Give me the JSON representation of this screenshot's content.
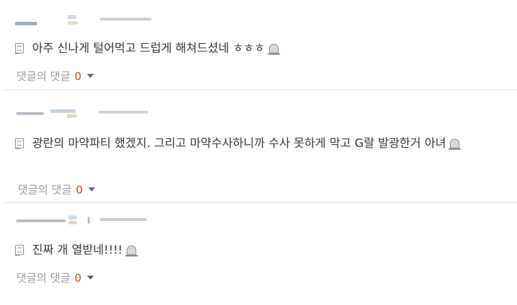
{
  "comments": [
    {
      "text": "아주 신나게 털어먹고 드럽게 해쳐드셨네 ㅎㅎㅎ",
      "reply_label": "댓글의 댓글",
      "reply_count": "0",
      "icons": [
        "memo-icon",
        "grave-icon",
        "caret-down-icon"
      ]
    },
    {
      "text": "광란의 마약파티 했겠지. 그리고 마약수사하니까 수사 못하게 막고 G랄 발광한거 아녀",
      "reply_label": "댓글의 댓글",
      "reply_count": "0",
      "icons": [
        "memo-icon",
        "grave-icon",
        "caret-down-icon"
      ]
    },
    {
      "text": "진짜 개 열받네!!!!",
      "reply_label": "댓글의 댓글",
      "reply_count": "0",
      "icons": [
        "memo-icon",
        "grave-icon",
        "caret-down-icon"
      ]
    }
  ],
  "colors": {
    "reply_count": "#d0451b",
    "reply_label": "#999999",
    "text": "#333333",
    "divider": "#dedede"
  }
}
